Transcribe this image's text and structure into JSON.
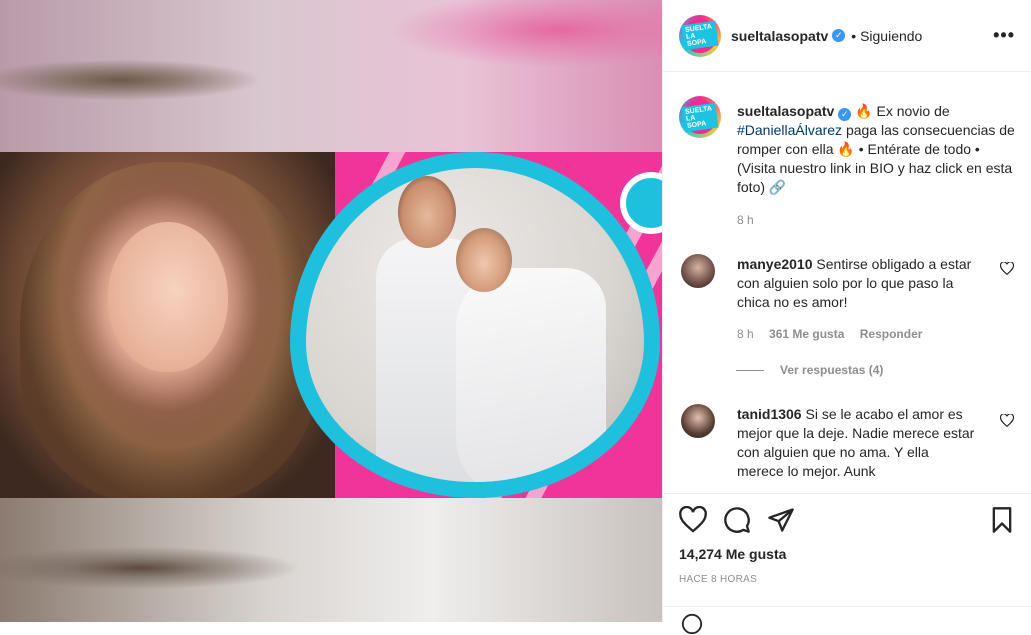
{
  "post": {
    "username": "sueltalasopatv",
    "follow_status": "Siguiendo",
    "more_label": "•••"
  },
  "caption": {
    "username": "sueltalasopatv",
    "emoji_fire": "🔥",
    "text_part1": " Ex novio de ",
    "hashtag": "#DaniellaÁlvarez",
    "text_part2": " paga las consecuencias de romper con ella ",
    "text_part3": " • Entérate de todo • (Visita nuestro link in BIO y haz click en esta foto) ",
    "emoji_link": "🔗",
    "time": "8 h"
  },
  "comments": [
    {
      "username": "manye2010",
      "text": "Sentirse obligado a estar con alguien solo por lo que paso la chica no es amor!",
      "time": "8 h",
      "likes": "361 Me gusta",
      "reply": "Responder",
      "view_replies": "Ver respuestas (4)"
    },
    {
      "username": "tanid1306",
      "text": "Si se le acabo el amor es mejor que la deje. Nadie merece estar con alguien que no ama. Y ella merece lo mejor. Aunk"
    }
  ],
  "actions": {
    "likes": "14,274 Me gusta",
    "timestamp": "HACE 8 HORAS"
  },
  "image": {
    "logo_text": "SUELTA LA SOPA"
  }
}
